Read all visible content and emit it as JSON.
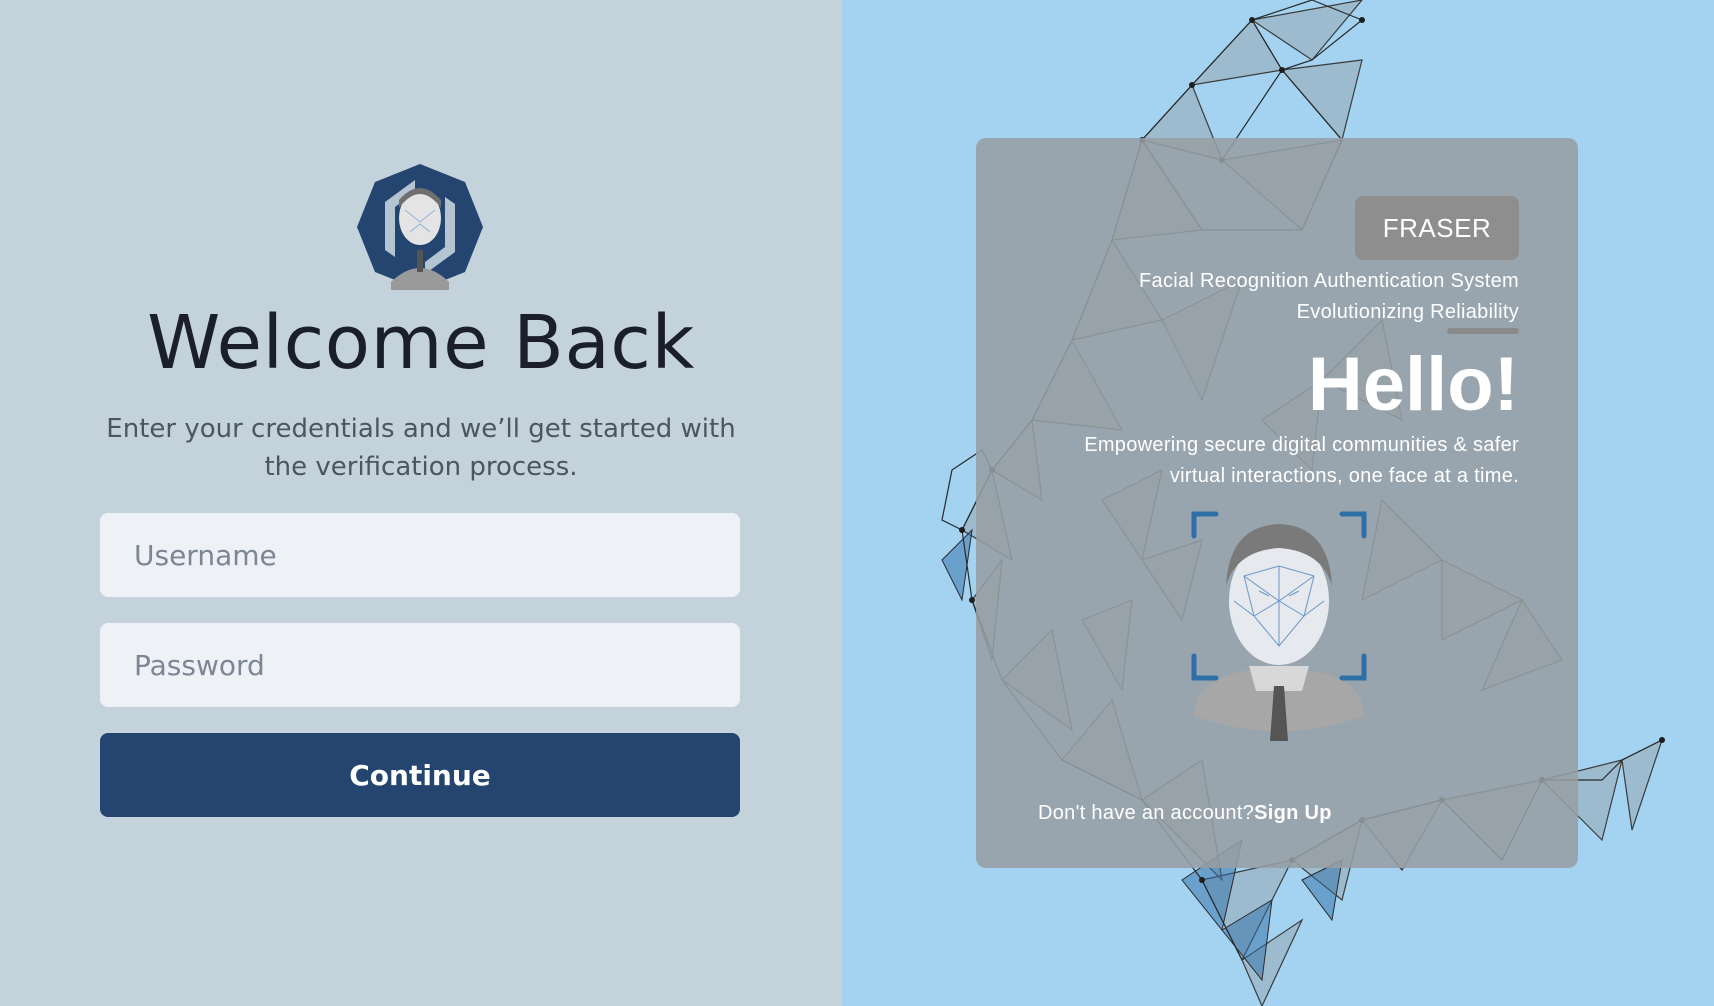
{
  "login": {
    "title": "Welcome Back",
    "subtitle": "Enter your credentials and we’ll get started with the verification process.",
    "username_placeholder": "Username",
    "username_value": "",
    "password_placeholder": "Password",
    "password_value": "",
    "continue_label": "Continue",
    "logo_icon": "face-scan-logo-icon"
  },
  "panel": {
    "brand": "FRASER",
    "tagline_line1": "Facial Recognition Authentication System",
    "tagline_line2": "Evolutionizing Reliability",
    "hello": "Hello!",
    "blurb_line1": "Empowering secure digital communities & safer",
    "blurb_line2": "virtual interactions, one face at a time.",
    "signup_prompt": "Don't have an account?",
    "signup_link": "Sign Up",
    "face_icon": "face-scan-icon"
  },
  "colors": {
    "left_background": "#c4d2dc",
    "right_background": "#a3d3f1",
    "primary_button": "#24456f",
    "input_background": "#eef2f7",
    "card_overlay": "#969ea4"
  }
}
